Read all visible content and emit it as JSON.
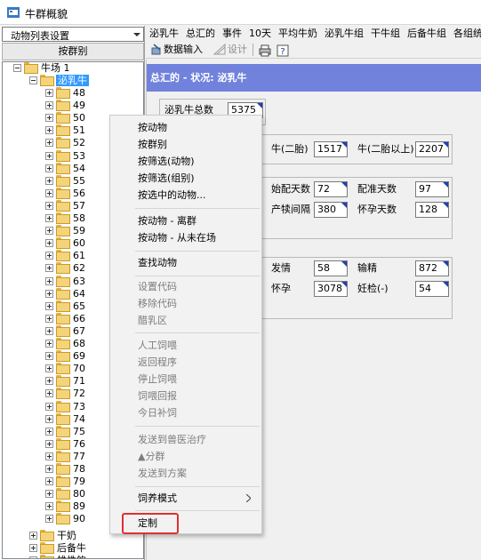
{
  "window": {
    "title": "牛群概貌"
  },
  "left_pane": {
    "combo_value": "动物列表设置",
    "group_button": "按群别",
    "tree": {
      "root": "牛场 1",
      "selected": "泌乳牛",
      "groups": [
        "48",
        "49",
        "50",
        "51",
        "52",
        "53",
        "54",
        "55",
        "56",
        "57",
        "58",
        "59",
        "60",
        "61",
        "62",
        "63",
        "64",
        "65",
        "66",
        "67",
        "68",
        "69",
        "70",
        "71",
        "72",
        "73",
        "74",
        "75",
        "76",
        "77",
        "78",
        "79",
        "80",
        "89",
        "90"
      ],
      "others": [
        "干奶",
        "后备牛",
        "雄性的"
      ]
    }
  },
  "menubar": [
    "泌乳牛",
    "总汇的",
    "事件",
    "10天",
    "平均牛奶",
    "泌乳牛组",
    "干牛组",
    "后备牛组",
    "各组统计"
  ],
  "toolbar": {
    "data_input": "数据输入",
    "design": "设计"
  },
  "summary": {
    "header": "总汇的 - 状况: 泌乳牛",
    "total_label": "泌乳牛总数",
    "total_value": "5375",
    "parity2_label": "牛(二胎)",
    "parity2_value": "1517",
    "parity2plus_label": "牛(二胎以上)",
    "parity2plus_value": "2207",
    "start_breed_label": "始配天数",
    "start_breed_value": "72",
    "open_days_label": "配准天数",
    "open_days_value": "97",
    "calving_interval_label": "产犊间隔",
    "calving_interval_value": "380",
    "gestation_label": "怀孕天数",
    "gestation_value": "128",
    "heat_label": "发情",
    "heat_value": "58",
    "insem_label": "输精",
    "insem_value": "872",
    "pregnant_label": "怀孕",
    "pregnant_value": "3078",
    "pregcheck_neg_label": "妊检(-)",
    "pregcheck_neg_value": "54"
  },
  "context_menu": {
    "items_group1": [
      "按动物",
      "按群别",
      "按筛选(动物)",
      "按筛选(组别)",
      "按选中的动物..."
    ],
    "items_group2": [
      "按动物 - 离群",
      "按动物 - 从未在场"
    ],
    "items_group3": [
      "查找动物"
    ],
    "items_group4": [
      "设置代码",
      "移除代码",
      "醋乳区"
    ],
    "items_group5": [
      "人工饲喂",
      "返回程序",
      "停止饲喂",
      "饲喂回报",
      "今日补饲"
    ],
    "items_group6": [
      "发送到兽医治疗",
      "▲分群",
      "发送到方案"
    ],
    "items_group7": [
      "饲养模式"
    ],
    "items_group8": [
      "定制"
    ]
  },
  "colors": {
    "header_band": "#7082dc",
    "selection": "#3399ff",
    "highlight": "#e03030"
  }
}
